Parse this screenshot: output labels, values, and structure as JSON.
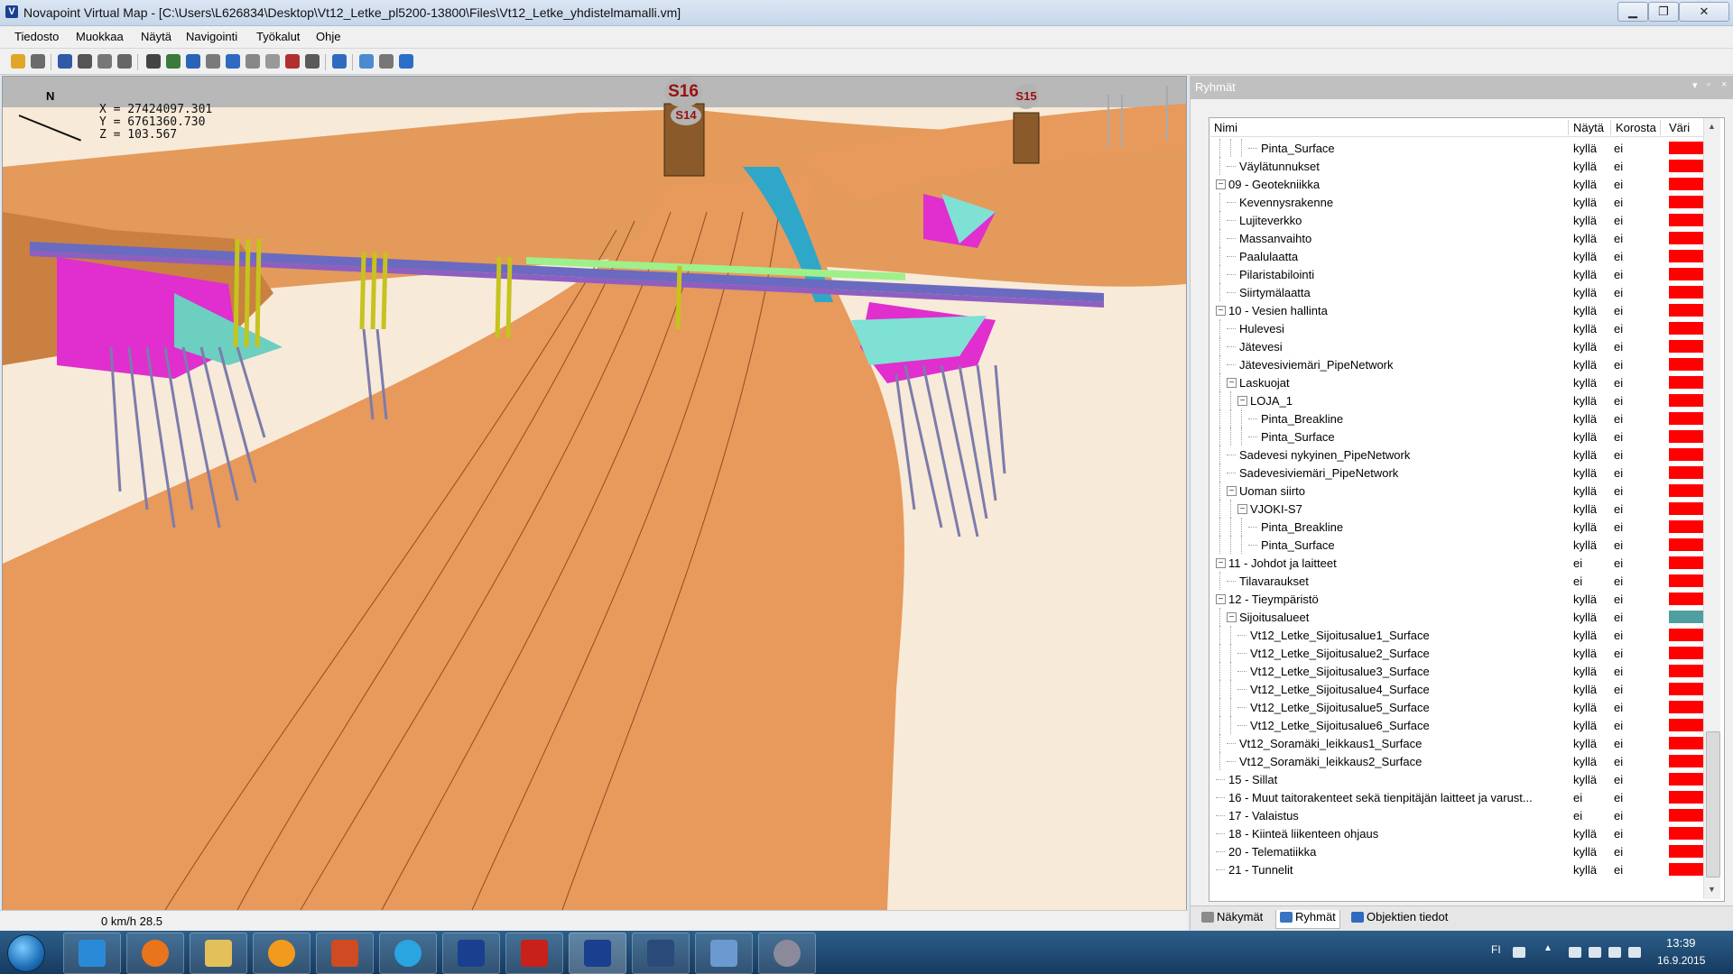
{
  "window": {
    "title": "Novapoint Virtual Map - [C:\\Users\\L626834\\Desktop\\Vt12_Letke_pl5200-13800\\Files\\Vt12_Letke_yhdistelmamalli.vm]",
    "min_glyph": "▁",
    "max_glyph": "❐",
    "close_glyph": "✕",
    "app_glyph": "V"
  },
  "menu": {
    "items": [
      "Tiedosto",
      "Muokkaa",
      "Näytä",
      "Navigointi",
      "Työkalut",
      "Ohje"
    ]
  },
  "viewport": {
    "north": "N",
    "coords": {
      "x": "X = 27424097.301",
      "y": "Y = 6761360.730",
      "z": "Z = 103.567"
    },
    "stations": [
      "S16",
      "S14",
      "S15"
    ]
  },
  "status": {
    "text": "0 km/h  28.5"
  },
  "panel": {
    "title": "Ryhmät",
    "controls": [
      "▾",
      "▫",
      "×"
    ],
    "columns": {
      "name": "Nimi",
      "show": "Näytä",
      "highlight": "Korosta",
      "color": "Väri"
    },
    "colors": {
      "red": "#ff0000",
      "teal": "#4f9ea0"
    },
    "rows": [
      {
        "label": "Pinta_Surface",
        "show": "kyllä",
        "hl": "ei",
        "color": "#ff0000",
        "level": 4,
        "expander": ""
      },
      {
        "label": "Väylätunnukset",
        "show": "kyllä",
        "hl": "ei",
        "color": "#ff0000",
        "level": 2,
        "expander": ""
      },
      {
        "label": "09 - Geotekniikka",
        "show": "kyllä",
        "hl": "ei",
        "color": "#ff0000",
        "level": 1,
        "expander": "−"
      },
      {
        "label": "Kevennysrakenne",
        "show": "kyllä",
        "hl": "ei",
        "color": "#ff0000",
        "level": 2,
        "expander": ""
      },
      {
        "label": "Lujiteverkko",
        "show": "kyllä",
        "hl": "ei",
        "color": "#ff0000",
        "level": 2,
        "expander": ""
      },
      {
        "label": "Massanvaihto",
        "show": "kyllä",
        "hl": "ei",
        "color": "#ff0000",
        "level": 2,
        "expander": ""
      },
      {
        "label": "Paalulaatta",
        "show": "kyllä",
        "hl": "ei",
        "color": "#ff0000",
        "level": 2,
        "expander": ""
      },
      {
        "label": "Pilaristabilointi",
        "show": "kyllä",
        "hl": "ei",
        "color": "#ff0000",
        "level": 2,
        "expander": ""
      },
      {
        "label": "Siirtymälaatta",
        "show": "kyllä",
        "hl": "ei",
        "color": "#ff0000",
        "level": 2,
        "expander": ""
      },
      {
        "label": "10 - Vesien hallinta",
        "show": "kyllä",
        "hl": "ei",
        "color": "#ff0000",
        "level": 1,
        "expander": "−"
      },
      {
        "label": "Hulevesi",
        "show": "kyllä",
        "hl": "ei",
        "color": "#ff0000",
        "level": 2,
        "expander": ""
      },
      {
        "label": "Jätevesi",
        "show": "kyllä",
        "hl": "ei",
        "color": "#ff0000",
        "level": 2,
        "expander": ""
      },
      {
        "label": "Jätevesiviemäri_PipeNetwork",
        "show": "kyllä",
        "hl": "ei",
        "color": "#ff0000",
        "level": 2,
        "expander": ""
      },
      {
        "label": "Laskuojat",
        "show": "kyllä",
        "hl": "ei",
        "color": "#ff0000",
        "level": 2,
        "expander": "−"
      },
      {
        "label": "LOJA_1",
        "show": "kyllä",
        "hl": "ei",
        "color": "#ff0000",
        "level": 3,
        "expander": "−"
      },
      {
        "label": "Pinta_Breakline",
        "show": "kyllä",
        "hl": "ei",
        "color": "#ff0000",
        "level": 4,
        "expander": ""
      },
      {
        "label": "Pinta_Surface",
        "show": "kyllä",
        "hl": "ei",
        "color": "#ff0000",
        "level": 4,
        "expander": ""
      },
      {
        "label": "Sadevesi nykyinen_PipeNetwork",
        "show": "kyllä",
        "hl": "ei",
        "color": "#ff0000",
        "level": 2,
        "expander": ""
      },
      {
        "label": "Sadevesiviemäri_PipeNetwork",
        "show": "kyllä",
        "hl": "ei",
        "color": "#ff0000",
        "level": 2,
        "expander": ""
      },
      {
        "label": "Uoman siirto",
        "show": "kyllä",
        "hl": "ei",
        "color": "#ff0000",
        "level": 2,
        "expander": "−"
      },
      {
        "label": "VJOKI-S7",
        "show": "kyllä",
        "hl": "ei",
        "color": "#ff0000",
        "level": 3,
        "expander": "−"
      },
      {
        "label": "Pinta_Breakline",
        "show": "kyllä",
        "hl": "ei",
        "color": "#ff0000",
        "level": 4,
        "expander": ""
      },
      {
        "label": "Pinta_Surface",
        "show": "kyllä",
        "hl": "ei",
        "color": "#ff0000",
        "level": 4,
        "expander": ""
      },
      {
        "label": "11 - Johdot ja laitteet",
        "show": "ei",
        "hl": "ei",
        "color": "#ff0000",
        "level": 1,
        "expander": "−"
      },
      {
        "label": "Tilavaraukset",
        "show": "ei",
        "hl": "ei",
        "color": "#ff0000",
        "level": 2,
        "expander": ""
      },
      {
        "label": "12 - Tieympäristö",
        "show": "kyllä",
        "hl": "ei",
        "color": "#ff0000",
        "level": 1,
        "expander": "−"
      },
      {
        "label": "Sijoitusalueet",
        "show": "kyllä",
        "hl": "ei",
        "color": "#4f9ea0",
        "level": 2,
        "expander": "−"
      },
      {
        "label": "Vt12_Letke_Sijoitusalue1_Surface",
        "show": "kyllä",
        "hl": "ei",
        "color": "#ff0000",
        "level": 3,
        "expander": ""
      },
      {
        "label": "Vt12_Letke_Sijoitusalue2_Surface",
        "show": "kyllä",
        "hl": "ei",
        "color": "#ff0000",
        "level": 3,
        "expander": ""
      },
      {
        "label": "Vt12_Letke_Sijoitusalue3_Surface",
        "show": "kyllä",
        "hl": "ei",
        "color": "#ff0000",
        "level": 3,
        "expander": ""
      },
      {
        "label": "Vt12_Letke_Sijoitusalue4_Surface",
        "show": "kyllä",
        "hl": "ei",
        "color": "#ff0000",
        "level": 3,
        "expander": ""
      },
      {
        "label": "Vt12_Letke_Sijoitusalue5_Surface",
        "show": "kyllä",
        "hl": "ei",
        "color": "#ff0000",
        "level": 3,
        "expander": ""
      },
      {
        "label": "Vt12_Letke_Sijoitusalue6_Surface",
        "show": "kyllä",
        "hl": "ei",
        "color": "#ff0000",
        "level": 3,
        "expander": ""
      },
      {
        "label": "Vt12_Soramäki_leikkaus1_Surface",
        "show": "kyllä",
        "hl": "ei",
        "color": "#ff0000",
        "level": 2,
        "expander": ""
      },
      {
        "label": "Vt12_Soramäki_leikkaus2_Surface",
        "show": "kyllä",
        "hl": "ei",
        "color": "#ff0000",
        "level": 2,
        "expander": ""
      },
      {
        "label": "15 - Sillat",
        "show": "kyllä",
        "hl": "ei",
        "color": "#ff0000",
        "level": 1,
        "expander": ""
      },
      {
        "label": "16 - Muut taitorakenteet sekä tienpitäjän laitteet ja varust...",
        "show": "ei",
        "hl": "ei",
        "color": "#ff0000",
        "level": 1,
        "expander": ""
      },
      {
        "label": "17 - Valaistus",
        "show": "ei",
        "hl": "ei",
        "color": "#ff0000",
        "level": 1,
        "expander": ""
      },
      {
        "label": "18 - Kiinteä liikenteen ohjaus",
        "show": "kyllä",
        "hl": "ei",
        "color": "#ff0000",
        "level": 1,
        "expander": ""
      },
      {
        "label": "20 - Telematiikka",
        "show": "kyllä",
        "hl": "ei",
        "color": "#ff0000",
        "level": 1,
        "expander": ""
      },
      {
        "label": "21 - Tunnelit",
        "show": "kyllä",
        "hl": "ei",
        "color": "#ff0000",
        "level": 1,
        "expander": ""
      }
    ],
    "tabs": [
      {
        "label": "Näkymät",
        "icon": "views-icon",
        "active": false
      },
      {
        "label": "Ryhmät",
        "icon": "groups-icon",
        "active": true
      },
      {
        "label": "Objektien tiedot",
        "icon": "info-icon",
        "active": false
      }
    ]
  },
  "taskbar": {
    "lang": "FI",
    "time": "13:39",
    "date": "16.9.2015"
  }
}
